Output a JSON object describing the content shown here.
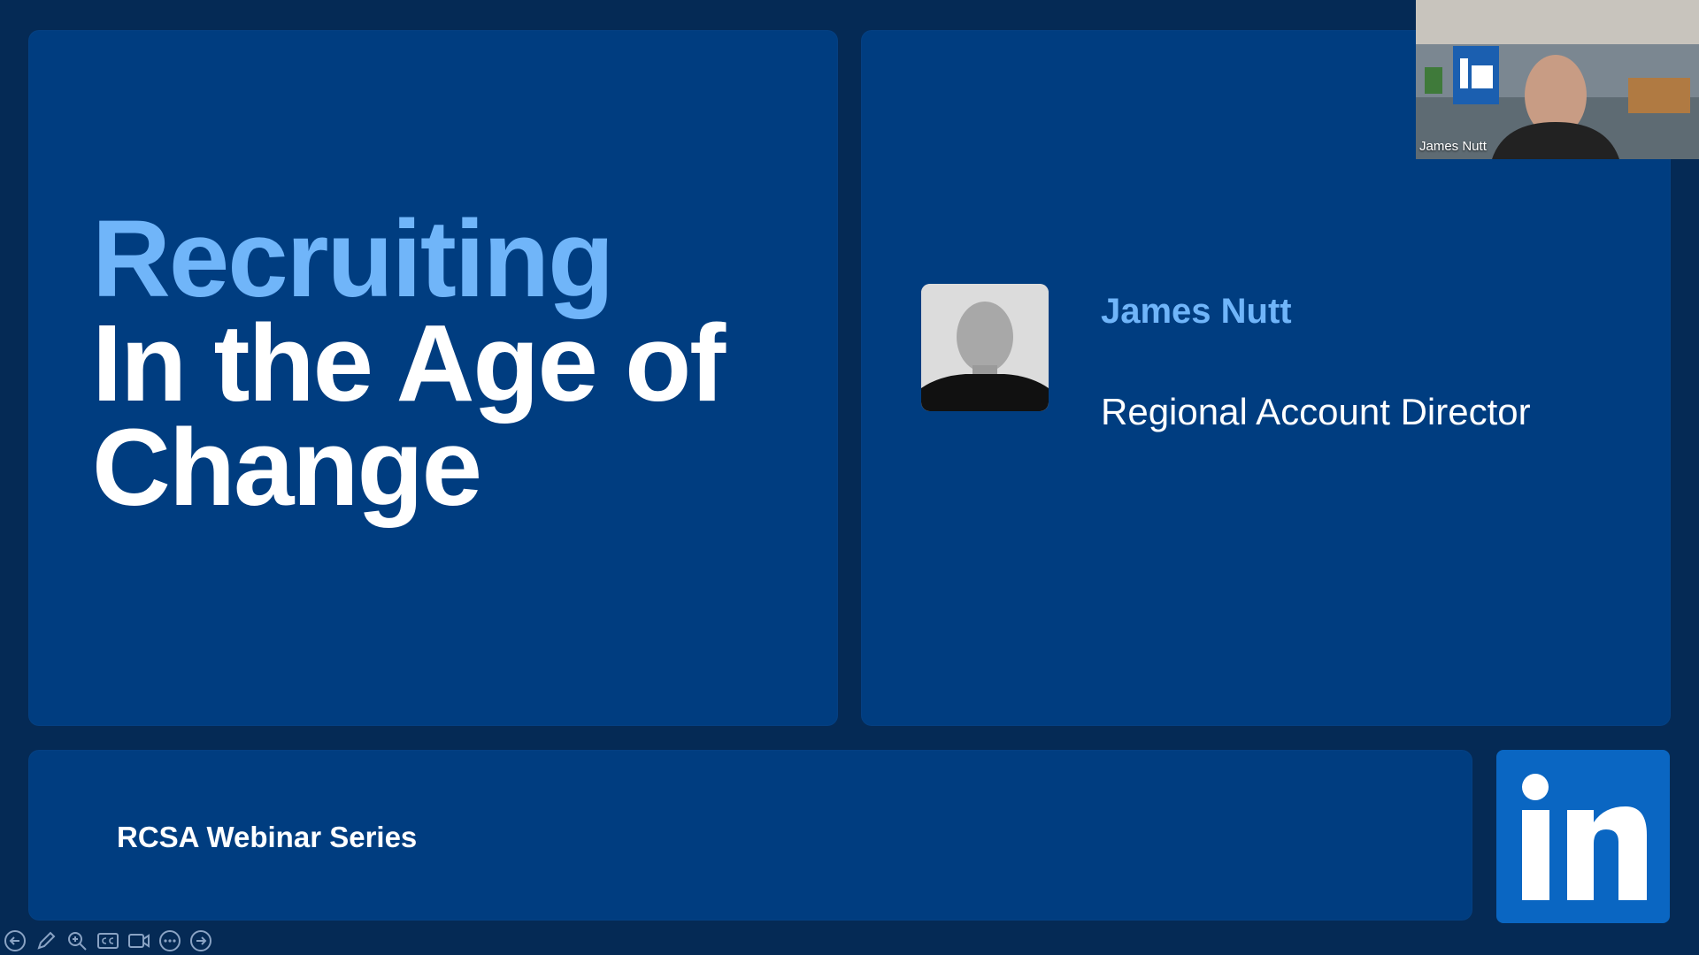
{
  "slide": {
    "title_line1": "Recruiting",
    "title_line2": "In the Age of",
    "title_line3": "Change",
    "speaker_name": "James Nutt",
    "speaker_role": "Regional Account Director",
    "series": "RCSA Webinar Series",
    "logo_text": "in"
  },
  "video": {
    "participant_name": "James Nutt"
  },
  "toolbar": {
    "icons": [
      "back-icon",
      "pen-icon",
      "zoom-icon",
      "captions-icon",
      "camera-icon",
      "more-icon",
      "forward-icon"
    ]
  },
  "colors": {
    "background": "#052a55",
    "panel": "#003d80",
    "accent": "#70b5f9",
    "linkedin": "#0a66c2"
  }
}
